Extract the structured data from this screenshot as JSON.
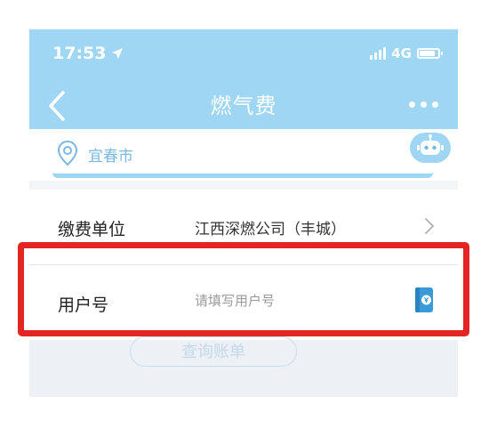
{
  "status_bar": {
    "time": "17:53",
    "network": "4G",
    "location_icon": "location-arrow-icon"
  },
  "header": {
    "title": "燃气费",
    "back_icon": "back-chevron-icon",
    "more_icon": "more-dots-icon"
  },
  "location": {
    "city": "宜春市",
    "pin_icon": "map-pin-icon",
    "robot_icon": "robot-icon"
  },
  "form": {
    "pay_unit": {
      "label": "缴费单位",
      "value": "江西深燃公司（丰城）"
    },
    "user_number": {
      "label": "用户号",
      "placeholder": "请填写用户号",
      "value": "",
      "book_icon": "account-book-icon"
    }
  },
  "actions": {
    "query_label": "查询账单"
  },
  "colors": {
    "header": "#9fd6f4",
    "highlight": "#e42525",
    "accent": "#3a9ad9"
  }
}
